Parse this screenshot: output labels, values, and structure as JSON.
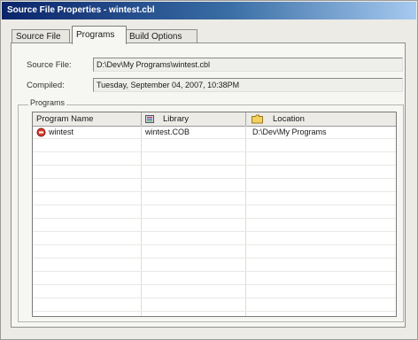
{
  "window": {
    "title": "Source File Properties - wintest.cbl"
  },
  "tabs": [
    {
      "label": "Source File"
    },
    {
      "label": "Programs"
    },
    {
      "label": "Build Options"
    }
  ],
  "fields": {
    "source_file": {
      "label": "Source File:",
      "value": "D:\\Dev\\My Programs\\wintest.cbl"
    },
    "compiled": {
      "label": "Compiled:",
      "value": "Tuesday, September 04, 2007, 10:38PM"
    }
  },
  "programs_group": {
    "legend": "Programs",
    "columns": [
      {
        "label": "Program Name",
        "icon": "none"
      },
      {
        "label": "Library",
        "icon": "library-icon"
      },
      {
        "label": "Location",
        "icon": "folder-icon"
      }
    ],
    "rows": [
      {
        "program": "wintest",
        "library": "wintest.COB",
        "location": "D:\\Dev\\My Programs",
        "icon": "program-icon"
      }
    ]
  },
  "colors": {
    "titlebar_start": "#0a246a",
    "titlebar_end": "#a6caf0",
    "window_bg": "#ecebe6",
    "panel_bg": "#f6f6f2"
  }
}
